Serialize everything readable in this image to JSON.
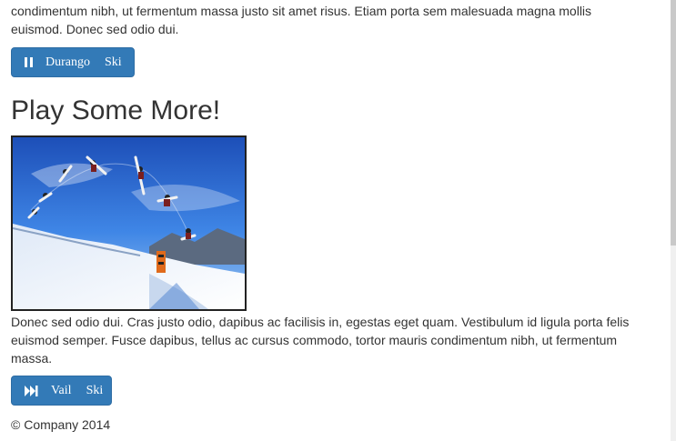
{
  "top_paragraph": {
    "line1": "condimentum nibh, ut fermentum massa justo sit amet risus. Etiam porta sem malesuada magna mollis",
    "line2": "euismod. Donec sed odio dui."
  },
  "durango_button": {
    "word1": "Durango",
    "word2": "Ski",
    "icon": "pause-icon"
  },
  "section_heading": "Play Some More!",
  "photo": {
    "subject": "snowboarder-jump-sequence",
    "alt": ""
  },
  "bottom_paragraph": {
    "line1": "Donec sed odio dui. Cras justo odio, dapibus ac facilisis in, egestas eget quam. Vestibulum id ligula porta felis",
    "line2": "euismod semper. Fusce dapibus, tellus ac cursus commodo, tortor mauris condimentum nibh, ut fermentum",
    "line3": "massa."
  },
  "vail_button": {
    "word1": "Vail",
    "word2": "Ski",
    "icon": "fast-forward-icon"
  },
  "footer": {
    "text": "© Company 2014"
  },
  "colors": {
    "button_bg": "#337ab7",
    "text": "#333333",
    "sky": "#2f6fd6",
    "snow": "#eef3fa"
  }
}
